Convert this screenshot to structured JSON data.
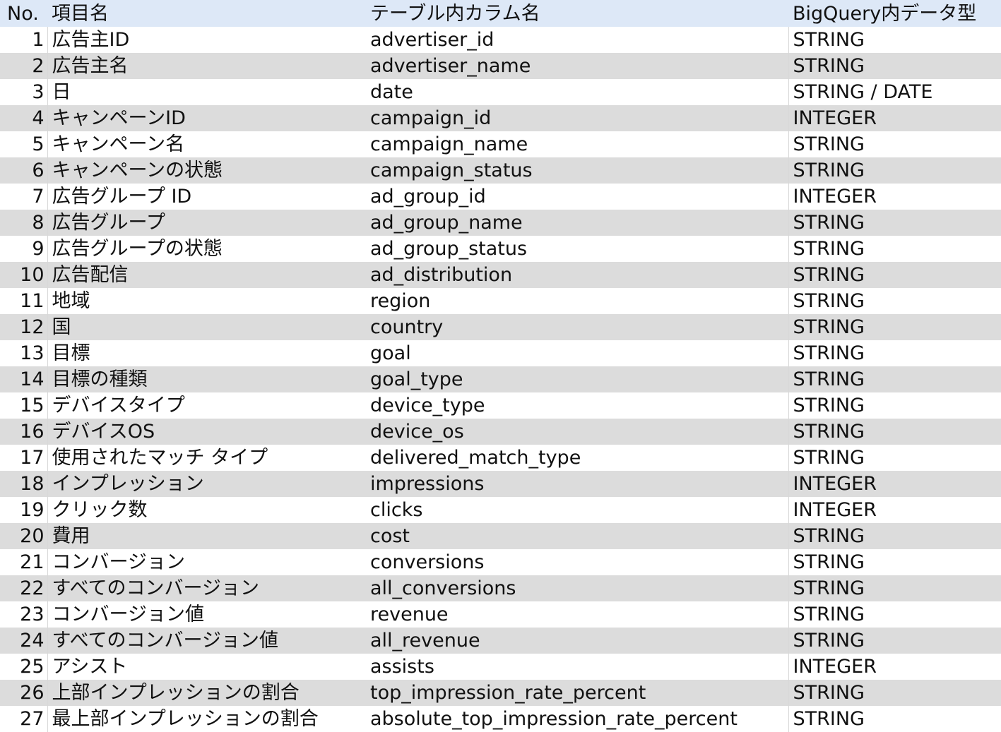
{
  "header": {
    "no": "No.",
    "item": "項目名",
    "column": "テーブル内カラム名",
    "type": "BigQuery内データ型"
  },
  "rows": [
    {
      "no": "1",
      "item": "広告主ID",
      "column": "advertiser_id",
      "type": "STRING"
    },
    {
      "no": "2",
      "item": "広告主名",
      "column": "advertiser_name",
      "type": "STRING"
    },
    {
      "no": "3",
      "item": "日",
      "column": "date",
      "type": "STRING / DATE"
    },
    {
      "no": "4",
      "item": "キャンペーンID",
      "column": "campaign_id",
      "type": "INTEGER"
    },
    {
      "no": "5",
      "item": "キャンペーン名",
      "column": "campaign_name",
      "type": "STRING"
    },
    {
      "no": "6",
      "item": "キャンペーンの状態",
      "column": "campaign_status",
      "type": "STRING"
    },
    {
      "no": "7",
      "item": "広告グループ ID",
      "column": "ad_group_id",
      "type": "INTEGER"
    },
    {
      "no": "8",
      "item": "広告グループ",
      "column": "ad_group_name",
      "type": "STRING"
    },
    {
      "no": "9",
      "item": "広告グループの状態",
      "column": "ad_group_status",
      "type": "STRING"
    },
    {
      "no": "10",
      "item": "広告配信",
      "column": "ad_distribution",
      "type": "STRING"
    },
    {
      "no": "11",
      "item": "地域",
      "column": "region",
      "type": "STRING"
    },
    {
      "no": "12",
      "item": "国",
      "column": "country",
      "type": "STRING"
    },
    {
      "no": "13",
      "item": "目標",
      "column": "goal",
      "type": "STRING"
    },
    {
      "no": "14",
      "item": "目標の種類",
      "column": "goal_type",
      "type": "STRING"
    },
    {
      "no": "15",
      "item": "デバイスタイプ",
      "column": "device_type",
      "type": "STRING"
    },
    {
      "no": "16",
      "item": "デバイスOS",
      "column": "device_os",
      "type": "STRING"
    },
    {
      "no": "17",
      "item": "使用されたマッチ タイプ",
      "column": "delivered_match_type",
      "type": "STRING"
    },
    {
      "no": "18",
      "item": "インプレッション",
      "column": "impressions",
      "type": "INTEGER"
    },
    {
      "no": "19",
      "item": "クリック数",
      "column": "clicks",
      "type": "INTEGER"
    },
    {
      "no": "20",
      "item": "費用",
      "column": "cost",
      "type": "STRING"
    },
    {
      "no": "21",
      "item": "コンバージョン",
      "column": "conversions",
      "type": "STRING"
    },
    {
      "no": "22",
      "item": "すべてのコンバージョン",
      "column": "all_conversions",
      "type": "STRING"
    },
    {
      "no": "23",
      "item": "コンバージョン値",
      "column": "revenue",
      "type": "STRING"
    },
    {
      "no": "24",
      "item": "すべてのコンバージョン値",
      "column": "all_revenue",
      "type": "STRING"
    },
    {
      "no": "25",
      "item": "アシスト",
      "column": "assists",
      "type": "INTEGER"
    },
    {
      "no": "26",
      "item": "上部インプレッションの割合",
      "column": "top_impression_rate_percent",
      "type": "STRING"
    },
    {
      "no": "27",
      "item": "最上部インプレッションの割合",
      "column": "absolute_top_impression_rate_percent",
      "type": "STRING"
    }
  ]
}
